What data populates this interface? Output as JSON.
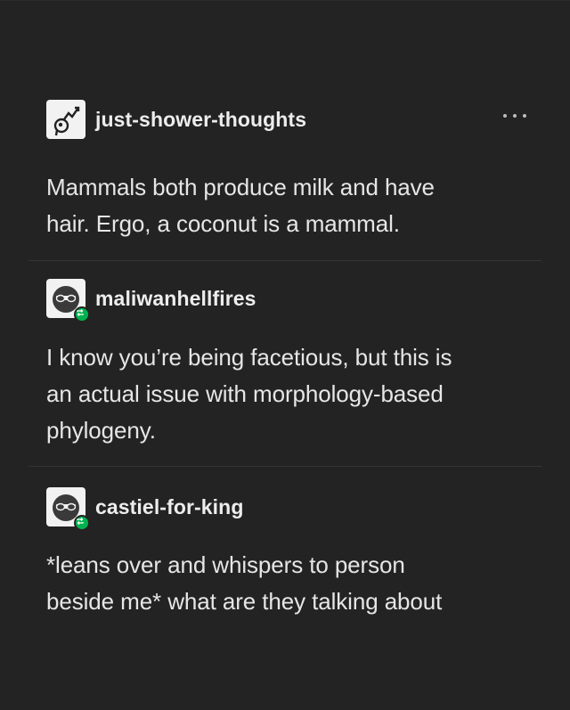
{
  "theme": {
    "background": "#232323",
    "text": "#e6e6e6",
    "reblog_badge": "#00b34f",
    "divider": "#343434"
  },
  "post": {
    "menu_icon": "more-horizontal-icon",
    "entries": [
      {
        "username": "just-shower-thoughts",
        "avatar_icon": "head-with-graph-icon",
        "text": "Mammals both produce milk and have\nhair. Ergo, a coconut is a mammal."
      },
      {
        "username": "maliwanhellfires",
        "avatar_icon": "sunglasses-avatar-icon",
        "badge_icon": "reblog-icon",
        "text": "I know you’re being facetious, but this is\nan actual issue with morphology-based\nphylogeny."
      },
      {
        "username": "castiel-for-king",
        "avatar_icon": "sunglasses-avatar-icon",
        "badge_icon": "reblog-icon",
        "text": "*leans over and whispers to person\nbeside me* what are they talking about"
      }
    ]
  }
}
